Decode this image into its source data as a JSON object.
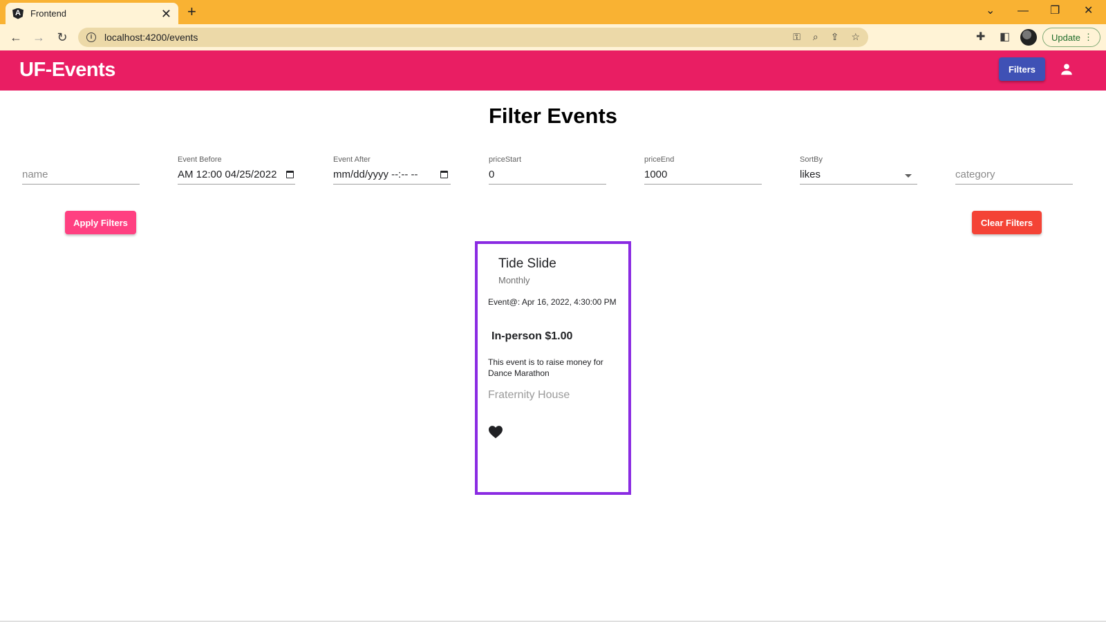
{
  "browser": {
    "tab_title": "Frontend",
    "tab_close": "✕",
    "new_tab": "+",
    "url": "localhost:4200/events",
    "update_label": "Update",
    "update_menu": "⋮",
    "window_controls": {
      "dropdown": "⌄",
      "minimize": "—",
      "restore": "❐",
      "close": "✕"
    },
    "nav": {
      "back": "←",
      "forward": "→",
      "reload": "↻"
    }
  },
  "header": {
    "brand": "UF-Events",
    "filters_label": "Filters"
  },
  "page": {
    "title": "Filter Events"
  },
  "filters": {
    "name": {
      "label": "",
      "placeholder": "name",
      "value": ""
    },
    "event_before": {
      "label": "Event Before",
      "value": "04/25/2022 12:00 AM"
    },
    "event_after": {
      "label": "Event After",
      "value": "mm/dd/yyyy --:-- --"
    },
    "price_start": {
      "label": "priceStart",
      "value": "0"
    },
    "price_end": {
      "label": "priceEnd",
      "value": "1000"
    },
    "sort_by": {
      "label": "SortBy",
      "value": "likes"
    },
    "category": {
      "label": "",
      "placeholder": "category",
      "value": ""
    }
  },
  "actions": {
    "apply_label": "Apply Filters",
    "clear_label": "Clear Filters"
  },
  "events": [
    {
      "title": "Tide Slide",
      "frequency": "Monthly",
      "date": "Event@: Apr 16, 2022, 4:30:00 PM",
      "price": "In-person $1.00",
      "description": "This event is to raise money for Dance Marathon",
      "location": "Fraternity House"
    }
  ],
  "colors": {
    "tabbar": "#f9b233",
    "header": "#e91e63",
    "filters_button": "#3f51b5",
    "apply_button": "#ff4081",
    "clear_button": "#f44336",
    "card_border": "#8a2be2"
  }
}
